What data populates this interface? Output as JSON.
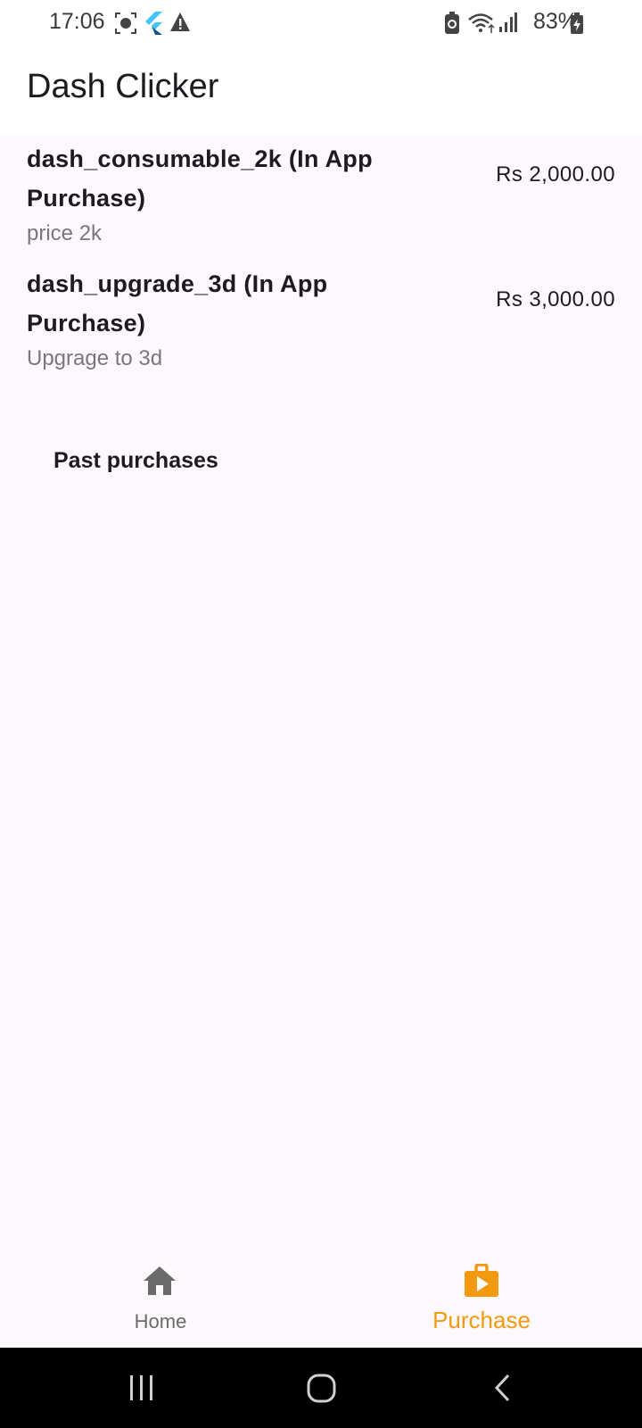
{
  "status_bar": {
    "time": "17:06",
    "battery": "83%",
    "icons": [
      "screenshot-icon",
      "flutter-icon",
      "warning-icon",
      "battery-saver-icon",
      "wifi-icon",
      "signal-icon",
      "battery-icon"
    ]
  },
  "app_bar": {
    "title": "Dash Clicker"
  },
  "products": [
    {
      "title": "dash_consumable_2k (In App Purchase)",
      "description": "price 2k",
      "price": "Rs 2,000.00"
    },
    {
      "title": "dash_upgrade_3d (In App Purchase)",
      "description": "Upgrage to 3d",
      "price": "Rs 3,000.00"
    }
  ],
  "past_purchases": {
    "title": "Past purchases"
  },
  "bottom_nav": {
    "items": [
      {
        "label": "Home",
        "icon": "home-icon",
        "selected": false
      },
      {
        "label": "Purchase",
        "icon": "shop-icon",
        "selected": true
      }
    ]
  },
  "colors": {
    "accent": "#f29a0f",
    "background": "#fdf8fc",
    "text": "#1d1b20",
    "secondary_text": "#7a757f"
  }
}
